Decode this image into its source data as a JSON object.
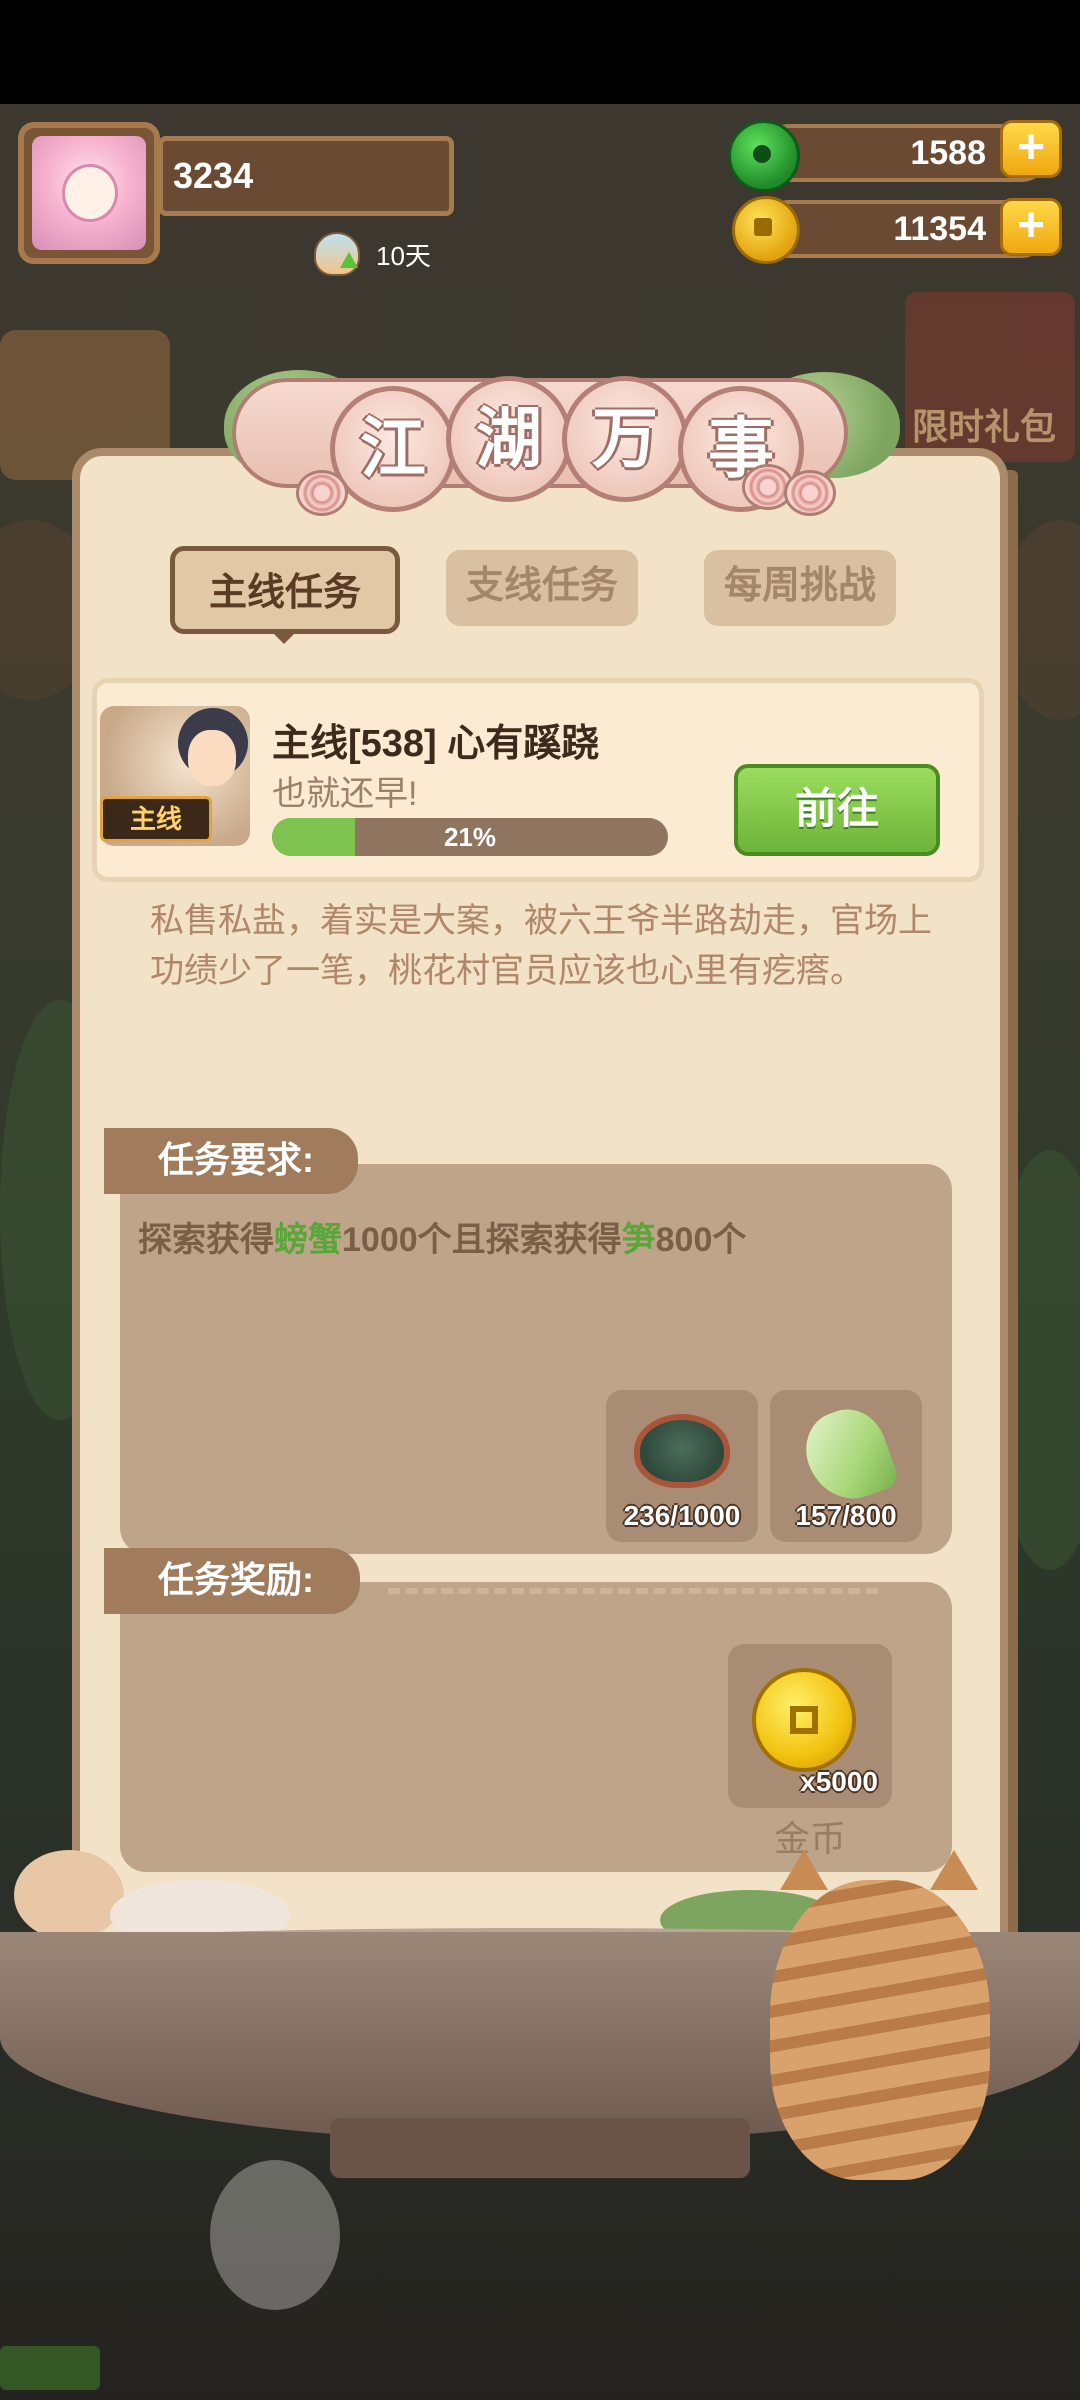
{
  "player": {
    "score": "3234",
    "days": "10天"
  },
  "resources": {
    "jade": "1588",
    "gold": "11354",
    "add_label": "+"
  },
  "side": {
    "gift_label": "限时礼包"
  },
  "panel": {
    "title_chars": [
      "江",
      "湖",
      "万",
      "事"
    ]
  },
  "tabs": [
    {
      "label": "主线任务",
      "active": true
    },
    {
      "label": "支线任务",
      "active": false
    },
    {
      "label": "每周挑战",
      "active": false
    }
  ],
  "quest": {
    "badge": "主线",
    "title": "主线[538] 心有蹊跷",
    "subtitle": "也就还早!",
    "progress_percent": 21,
    "progress_label": "21%",
    "go_button": "前往",
    "description": "私售私盐，着实是大案，被六王爷半路劫走，官场上功绩少了一笔，桃花村官员应该也心里有疙瘩。"
  },
  "requirements": {
    "label": "任务要求:",
    "text_parts": [
      {
        "text": "探索获得",
        "highlight": false
      },
      {
        "text": "螃蟹",
        "highlight": true
      },
      {
        "text": "1000个且探索获得",
        "highlight": false
      },
      {
        "text": "笋",
        "highlight": true
      },
      {
        "text": "800个",
        "highlight": false
      }
    ],
    "items": [
      {
        "icon": "crab-icon",
        "count": "236/1000"
      },
      {
        "icon": "bamboo-shoot-icon",
        "count": "157/800"
      }
    ]
  },
  "rewards": {
    "label": "任务奖励:",
    "items": [
      {
        "icon": "gold-coin-icon",
        "count": "x5000",
        "name": "金币"
      }
    ]
  },
  "colors": {
    "panel_bg": "#f2e2c7",
    "accent_green": "#7ec24f",
    "highlight_text": "#5aa63a",
    "label_brown": "#a07c5d"
  }
}
